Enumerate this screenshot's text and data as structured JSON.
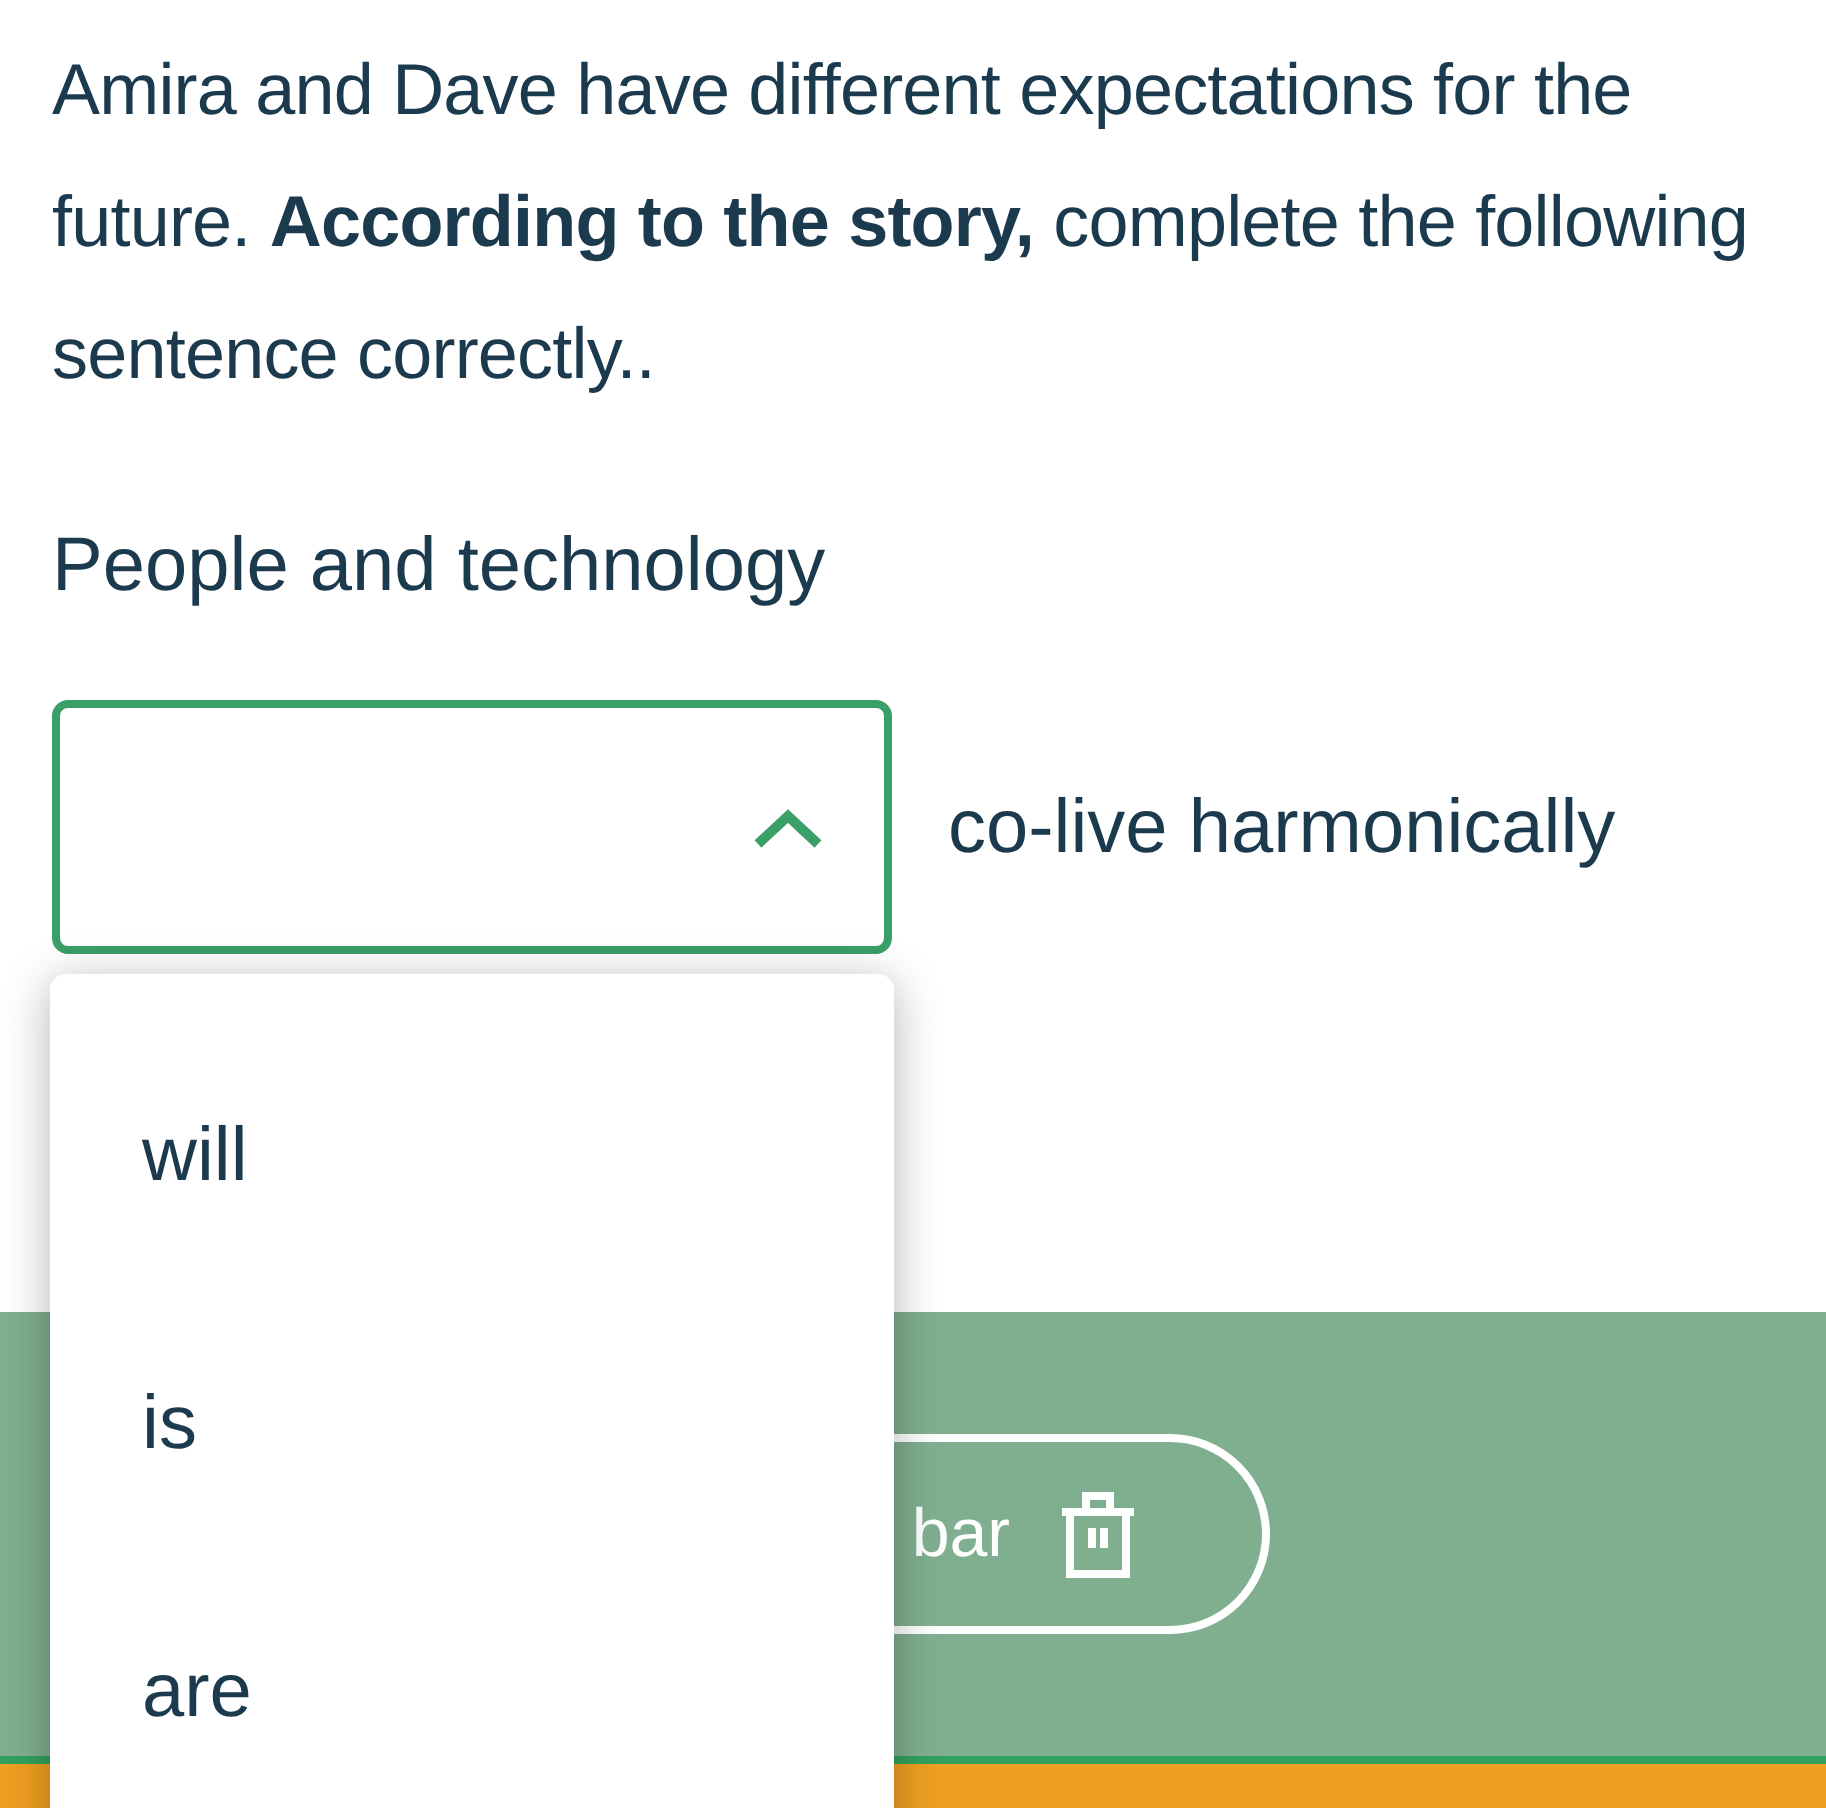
{
  "question": {
    "text": "Amira and Dave have different expectations for the future. **According to the story,** complete the following sentence correctly.."
  },
  "sentence": {
    "before": "People and technology",
    "after": "co-live harmonically"
  },
  "dropdown": {
    "expanded": true,
    "options": [
      {
        "label": "will",
        "selected": false
      },
      {
        "label": "is",
        "selected": false
      },
      {
        "label": "are",
        "selected": false
      }
    ]
  },
  "footer": {
    "button": {
      "label": "bar"
    }
  }
}
